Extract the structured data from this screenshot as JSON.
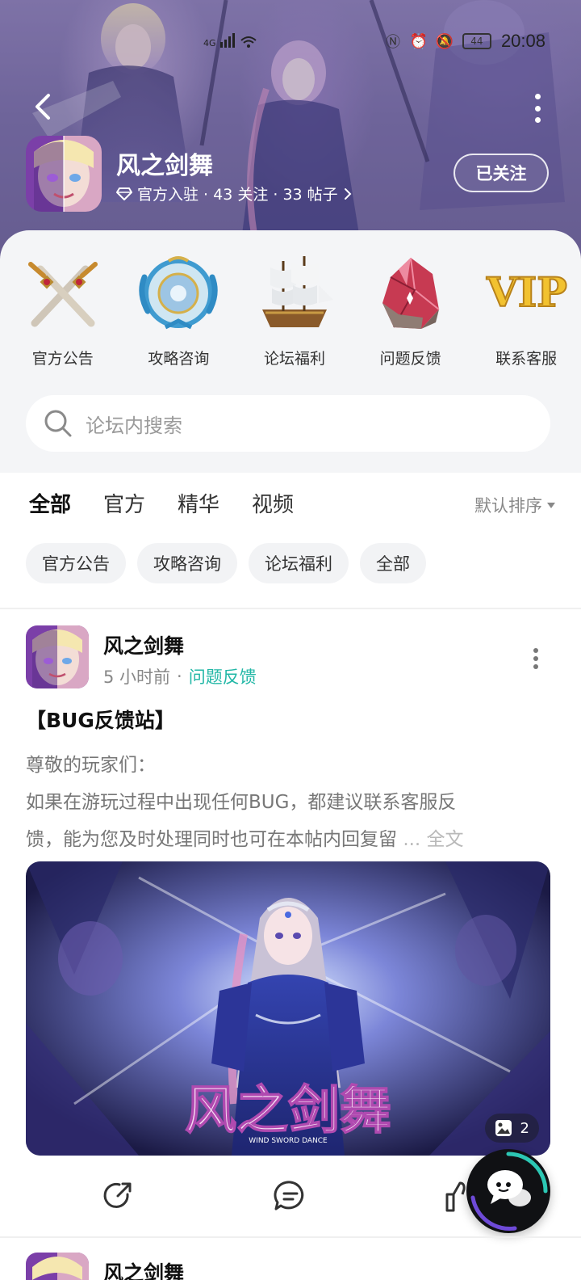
{
  "status_bar": {
    "time": "20:08",
    "battery": "44",
    "network": "4G"
  },
  "header": {
    "app_name": "风之剑舞",
    "meta": "官方入驻 · 43 关注 · 33 帖子",
    "follow_label": "已关注"
  },
  "entries": [
    {
      "label": "官方公告",
      "icon": "crossed-swords-icon"
    },
    {
      "label": "攻略咨询",
      "icon": "dragon-emblem-icon"
    },
    {
      "label": "论坛福利",
      "icon": "sailing-ship-icon"
    },
    {
      "label": "问题反馈",
      "icon": "red-crystal-icon"
    },
    {
      "label": "联系客服",
      "icon": "vip-badge-icon",
      "badge_text": "VIP"
    }
  ],
  "search": {
    "placeholder": "论坛内搜索"
  },
  "tabs": [
    {
      "label": "全部",
      "active": true
    },
    {
      "label": "官方",
      "active": false
    },
    {
      "label": "精华",
      "active": false
    },
    {
      "label": "视频",
      "active": false
    }
  ],
  "sort": {
    "label": "默认排序"
  },
  "chips": [
    "官方公告",
    "攻略咨询",
    "论坛福利",
    "全部"
  ],
  "post": {
    "author": "风之剑舞",
    "time": "5 小时前",
    "category": "问题反馈",
    "title": "【BUG反馈站】",
    "lines": [
      "尊敬的玩家们：",
      " 如果在游玩过程中出现任何BUG，都建议联系客服反",
      "馈，能为您及时处理同时也可在本帖内回复留"
    ],
    "more_label": "... 全文",
    "image_count": "2",
    "image_title": "风之剑舞",
    "image_subtitle": "WIND SWORD DANCE"
  },
  "next_post": {
    "author": "风之剑舞"
  },
  "colors": {
    "accent": "#2cc7b4",
    "category": "#22b7a6"
  }
}
